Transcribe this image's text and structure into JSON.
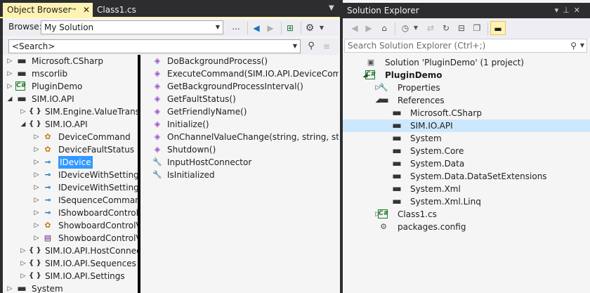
{
  "tabs": {
    "active": "Object Browser",
    "active_pin": "⊸",
    "active_close": "✕",
    "inactive": "Class1.cs"
  },
  "object_browser": {
    "browse_label": "Browse:",
    "browse_value": "My Solution",
    "more_button": "...",
    "search_value": "<Search>",
    "tree": [
      {
        "label": "Microsoft.CSharp",
        "icon": "assembly-icon",
        "indent": 0,
        "expander": "▷"
      },
      {
        "label": "mscorlib",
        "icon": "assembly-icon",
        "indent": 0,
        "expander": "▷"
      },
      {
        "label": "PluginDemo",
        "icon": "csharp-project-icon",
        "indent": 0,
        "expander": "▷"
      },
      {
        "label": "SIM.IO.API",
        "icon": "assembly-icon",
        "indent": 0,
        "expander": "◢"
      },
      {
        "label": "SIM.Engine.ValueTransfo",
        "icon": "namespace-icon",
        "indent": 1,
        "expander": "▷"
      },
      {
        "label": "SIM.IO.API",
        "icon": "namespace-icon",
        "indent": 1,
        "expander": "◢"
      },
      {
        "label": "DeviceCommand",
        "icon": "class-icon",
        "indent": 2,
        "expander": "▷"
      },
      {
        "label": "DeviceFaultStatus",
        "icon": "class-icon",
        "indent": 2,
        "expander": "▷"
      },
      {
        "label": "IDevice",
        "icon": "interface-icon",
        "indent": 2,
        "expander": "▷",
        "selected": true
      },
      {
        "label": "IDeviceWithSettings",
        "icon": "interface-icon",
        "indent": 2,
        "expander": "▷"
      },
      {
        "label": "IDeviceWithSettingsC",
        "icon": "interface-icon",
        "indent": 2,
        "expander": "▷"
      },
      {
        "label": "ISequenceCommand",
        "icon": "interface-icon",
        "indent": 2,
        "expander": "▷"
      },
      {
        "label": "IShowboardControl",
        "icon": "interface-icon",
        "indent": 2,
        "expander": "▷"
      },
      {
        "label": "ShowboardControlVa",
        "icon": "class-icon",
        "indent": 2,
        "expander": "▷"
      },
      {
        "label": "ShowboardControlVa",
        "icon": "enum-icon",
        "indent": 2,
        "expander": "▷"
      },
      {
        "label": "SIM.IO.API.HostConnecto",
        "icon": "namespace-icon",
        "indent": 1,
        "expander": "▷"
      },
      {
        "label": "SIM.IO.API.Sequences",
        "icon": "namespace-icon",
        "indent": 1,
        "expander": "▷"
      },
      {
        "label": "SIM.IO.API.Settings",
        "icon": "namespace-icon",
        "indent": 1,
        "expander": "▷"
      },
      {
        "label": "System",
        "icon": "assembly-icon",
        "indent": 0,
        "expander": "▷"
      }
    ],
    "members": [
      {
        "label": "DoBackgroundProcess()",
        "icon": "method-icon"
      },
      {
        "label": "ExecuteCommand(SIM.IO.API.DeviceComman",
        "icon": "method-icon"
      },
      {
        "label": "GetBackgroundProcessInterval()",
        "icon": "method-icon"
      },
      {
        "label": "GetFaultStatus()",
        "icon": "method-icon"
      },
      {
        "label": "GetFriendlyName()",
        "icon": "method-icon"
      },
      {
        "label": "Initialize()",
        "icon": "method-icon"
      },
      {
        "label": "OnChannelValueChange(string, string, string)",
        "icon": "method-icon"
      },
      {
        "label": "Shutdown()",
        "icon": "method-icon"
      },
      {
        "label": "InputHostConnector",
        "icon": "property-icon"
      },
      {
        "label": "IsInitialized",
        "icon": "property-icon"
      }
    ]
  },
  "solution_explorer": {
    "title": "Solution Explorer",
    "search_placeholder": "Search Solution Explorer (Ctrl+;)",
    "tree": [
      {
        "label": "Solution 'PluginDemo' (1 project)",
        "icon": "solution-icon",
        "indent": 0,
        "expander": ""
      },
      {
        "label": "PluginDemo",
        "icon": "csharp-project-icon",
        "indent": 0,
        "expander": "◢",
        "bold": true
      },
      {
        "label": "Properties",
        "icon": "wrench-icon",
        "indent": 1,
        "expander": "▷"
      },
      {
        "label": "References",
        "icon": "references-icon",
        "indent": 1,
        "expander": "◢"
      },
      {
        "label": "Microsoft.CSharp",
        "icon": "assembly-icon",
        "indent": 2,
        "expander": ""
      },
      {
        "label": "SIM.IO.API",
        "icon": "assembly-icon",
        "indent": 2,
        "expander": "",
        "selected": true
      },
      {
        "label": "System",
        "icon": "assembly-icon",
        "indent": 2,
        "expander": ""
      },
      {
        "label": "System.Core",
        "icon": "assembly-icon",
        "indent": 2,
        "expander": ""
      },
      {
        "label": "System.Data",
        "icon": "assembly-icon",
        "indent": 2,
        "expander": ""
      },
      {
        "label": "System.Data.DataSetExtensions",
        "icon": "assembly-icon",
        "indent": 2,
        "expander": ""
      },
      {
        "label": "System.Xml",
        "icon": "assembly-icon",
        "indent": 2,
        "expander": ""
      },
      {
        "label": "System.Xml.Linq",
        "icon": "assembly-icon",
        "indent": 2,
        "expander": ""
      },
      {
        "label": "Class1.cs",
        "icon": "csharp-file-icon",
        "indent": 1,
        "expander": "▷"
      },
      {
        "label": "packages.config",
        "icon": "config-file-icon",
        "indent": 1,
        "expander": ""
      }
    ]
  },
  "colors": {
    "chrome_dark": "#2d2d30",
    "active_tab": "#fff3b3",
    "selection_blue": "#3399ff",
    "selection_light": "#cce8ff"
  }
}
